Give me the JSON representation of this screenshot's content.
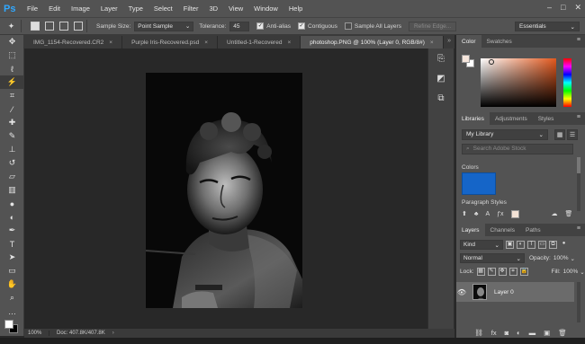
{
  "app": {
    "logo": "Ps",
    "menu": [
      "File",
      "Edit",
      "Image",
      "Layer",
      "Type",
      "Select",
      "Filter",
      "3D",
      "View",
      "Window",
      "Help"
    ],
    "window_controls": [
      "–",
      "□",
      "✕"
    ]
  },
  "options_bar": {
    "sample_size_label": "Sample Size:",
    "sample_size_value": "Point Sample",
    "tolerance_label": "Tolerance:",
    "tolerance_value": "45",
    "anti_alias": "Anti-alias",
    "contiguous": "Contiguous",
    "sample_all_layers": "Sample All Layers",
    "refine_edge": "Refine Edge...",
    "workspace": "Essentials",
    "anti_alias_checked": true,
    "contiguous_checked": true,
    "sample_all_layers_checked": false
  },
  "tabs": [
    {
      "label": "IMG_1154-Recovered.CR2",
      "active": false
    },
    {
      "label": "Purple Iris-Recovered.psd",
      "active": false
    },
    {
      "label": "Untitled-1-Recovered",
      "active": false
    },
    {
      "label": "photoshop.PNG @ 100% (Layer 0, RGB/8#)",
      "active": true
    }
  ],
  "status": {
    "zoom": "100%",
    "doc_info": "Doc: 407.8K/407.8K"
  },
  "panels": {
    "color_tabs": [
      "Color",
      "Swatches"
    ],
    "library_tabs": [
      "Libraries",
      "Adjustments",
      "Styles"
    ],
    "library_select": "My Library",
    "library_search_placeholder": "Search Adobe Stock",
    "colors_section": "Colors",
    "paragraph_styles_section": "Paragraph Styles",
    "layers_tabs": [
      "Layers",
      "Channels",
      "Paths"
    ],
    "kind_label": "Kind",
    "blend_mode": "Normal",
    "opacity_label": "Opacity:",
    "opacity_value": "100%",
    "lock_label": "Lock:",
    "fill_label": "Fill:",
    "fill_value": "100%",
    "layer_name": "Layer 0"
  },
  "colors": {
    "library_swatch": "#1565c8",
    "accent": "#31a8ff"
  },
  "icons": {
    "tools": [
      "move-icon",
      "marquee-icon",
      "lasso-icon",
      "magic-wand-icon",
      "crop-icon",
      "eyedropper-icon",
      "healing-brush-icon",
      "brush-icon",
      "clone-stamp-icon",
      "history-brush-icon",
      "eraser-icon",
      "gradient-icon",
      "blur-icon",
      "dodge-icon",
      "pen-icon",
      "type-icon",
      "path-selection-icon",
      "rectangle-icon",
      "hand-icon",
      "zoom-icon",
      "more-tools-icon"
    ]
  }
}
